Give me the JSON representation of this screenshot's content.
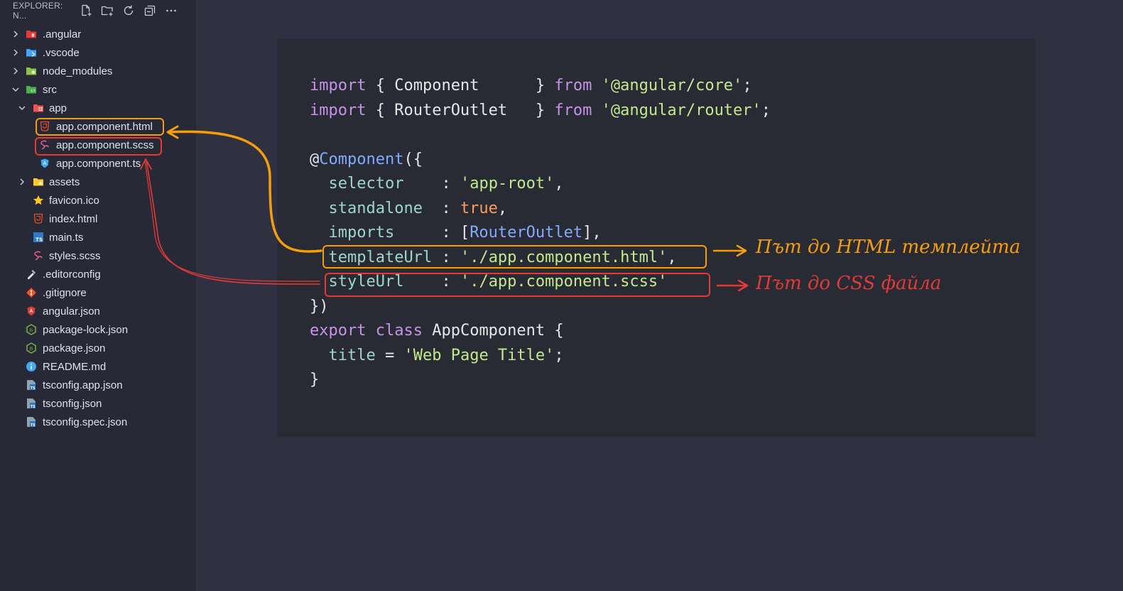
{
  "explorer": {
    "title": "EXPLORER: N...",
    "actions": [
      {
        "name": "new-file-icon"
      },
      {
        "name": "new-folder-icon"
      },
      {
        "name": "refresh-icon"
      },
      {
        "name": "collapse-all-icon"
      },
      {
        "name": "more-actions-icon"
      }
    ]
  },
  "tree": [
    {
      "label": ".angular",
      "type": "folder",
      "expanded": false,
      "icon": "angular-folder-icon",
      "color": "#e53935"
    },
    {
      "label": ".vscode",
      "type": "folder",
      "expanded": false,
      "icon": "vscode-folder-icon",
      "color": "#42a5f5"
    },
    {
      "label": "node_modules",
      "type": "folder",
      "expanded": false,
      "icon": "node-folder-icon",
      "color": "#8bc34a"
    },
    {
      "label": "src",
      "type": "folder",
      "expanded": true,
      "icon": "src-folder-icon",
      "color": "#4caf50"
    },
    {
      "label": "app",
      "type": "folder",
      "expanded": true,
      "icon": "app-folder-icon",
      "color": "#ef5350"
    },
    {
      "label": "app.component.html",
      "type": "file",
      "icon": "html5-icon",
      "color": "#e44d26"
    },
    {
      "label": "app.component.scss",
      "type": "file",
      "icon": "sass-icon",
      "color": "#f06292"
    },
    {
      "label": "app.component.ts",
      "type": "file",
      "icon": "angular-component-icon",
      "color": "#42a5f5"
    },
    {
      "label": "assets",
      "type": "folder",
      "expanded": false,
      "icon": "assets-folder-icon",
      "color": "#ffca28"
    },
    {
      "label": "favicon.ico",
      "type": "file",
      "icon": "star-icon",
      "color": "#ffca28"
    },
    {
      "label": "index.html",
      "type": "file",
      "icon": "html5-icon",
      "color": "#e44d26"
    },
    {
      "label": "main.ts",
      "type": "file",
      "icon": "typescript-icon",
      "color": "#3178c6"
    },
    {
      "label": "styles.scss",
      "type": "file",
      "icon": "sass-icon",
      "color": "#f06292"
    },
    {
      "label": ".editorconfig",
      "type": "file",
      "icon": "editorconfig-icon",
      "color": "#e0e0e0"
    },
    {
      "label": ".gitignore",
      "type": "file",
      "icon": "git-icon",
      "color": "#f4511e"
    },
    {
      "label": "angular.json",
      "type": "file",
      "icon": "angular-icon",
      "color": "#e53935"
    },
    {
      "label": "package-lock.json",
      "type": "file",
      "icon": "nodejs-icon",
      "color": "#8bc34a"
    },
    {
      "label": "package.json",
      "type": "file",
      "icon": "nodejs-icon",
      "color": "#8bc34a"
    },
    {
      "label": "README.md",
      "type": "file",
      "icon": "info-icon",
      "color": "#42a5f5"
    },
    {
      "label": "tsconfig.app.json",
      "type": "file",
      "icon": "tsconfig-icon",
      "color": "#3178c6"
    },
    {
      "label": "tsconfig.json",
      "type": "file",
      "icon": "tsconfig-icon",
      "color": "#3178c6"
    },
    {
      "label": "tsconfig.spec.json",
      "type": "file",
      "icon": "tsconfig-icon",
      "color": "#3178c6"
    }
  ],
  "code": {
    "lines": [
      [
        {
          "t": "import",
          "c": "kw"
        },
        {
          "t": " { Component      } "
        },
        {
          "t": "from",
          "c": "kw"
        },
        {
          "t": " "
        },
        {
          "t": "'@angular/core'",
          "c": "str"
        },
        {
          "t": ";"
        }
      ],
      [
        {
          "t": "import",
          "c": "kw"
        },
        {
          "t": " { RouterOutlet   } "
        },
        {
          "t": "from",
          "c": "kw"
        },
        {
          "t": " "
        },
        {
          "t": "'@angular/router'",
          "c": "str"
        },
        {
          "t": ";"
        }
      ],
      [
        {
          "t": ""
        }
      ],
      [
        {
          "t": "@"
        },
        {
          "t": "Component",
          "c": "fn"
        },
        {
          "t": "({"
        }
      ],
      [
        {
          "t": "  "
        },
        {
          "t": "selector",
          "c": "prop"
        },
        {
          "t": "    : "
        },
        {
          "t": "'app-root'",
          "c": "str"
        },
        {
          "t": ","
        }
      ],
      [
        {
          "t": "  "
        },
        {
          "t": "standalone",
          "c": "prop"
        },
        {
          "t": "  : "
        },
        {
          "t": "true",
          "c": "bool"
        },
        {
          "t": ","
        }
      ],
      [
        {
          "t": "  "
        },
        {
          "t": "imports",
          "c": "prop"
        },
        {
          "t": "     : ["
        },
        {
          "t": "RouterOutlet",
          "c": "fn"
        },
        {
          "t": "],"
        }
      ],
      [
        {
          "t": "  "
        },
        {
          "t": "templateUrl",
          "c": "prop"
        },
        {
          "t": " : "
        },
        {
          "t": "'./app.component.html'",
          "c": "str"
        },
        {
          "t": ","
        }
      ],
      [
        {
          "t": "  "
        },
        {
          "t": "styleUrl",
          "c": "prop"
        },
        {
          "t": "    : "
        },
        {
          "t": "'./app.component.scss'",
          "c": "str"
        }
      ],
      [
        {
          "t": "})"
        }
      ],
      [
        {
          "t": "export",
          "c": "kw"
        },
        {
          "t": " "
        },
        {
          "t": "class",
          "c": "kw"
        },
        {
          "t": " AppComponent {"
        }
      ],
      [
        {
          "t": "  "
        },
        {
          "t": "title",
          "c": "prop"
        },
        {
          "t": " = "
        },
        {
          "t": "'Web Page Title'",
          "c": "str"
        },
        {
          "t": ";"
        }
      ],
      [
        {
          "t": "}"
        }
      ]
    ]
  },
  "annotations": {
    "template_note": "Път до HTML темплейта",
    "style_note": "Път до CSS файла",
    "template_color": "#f59e0b",
    "style_color": "#e53935"
  }
}
